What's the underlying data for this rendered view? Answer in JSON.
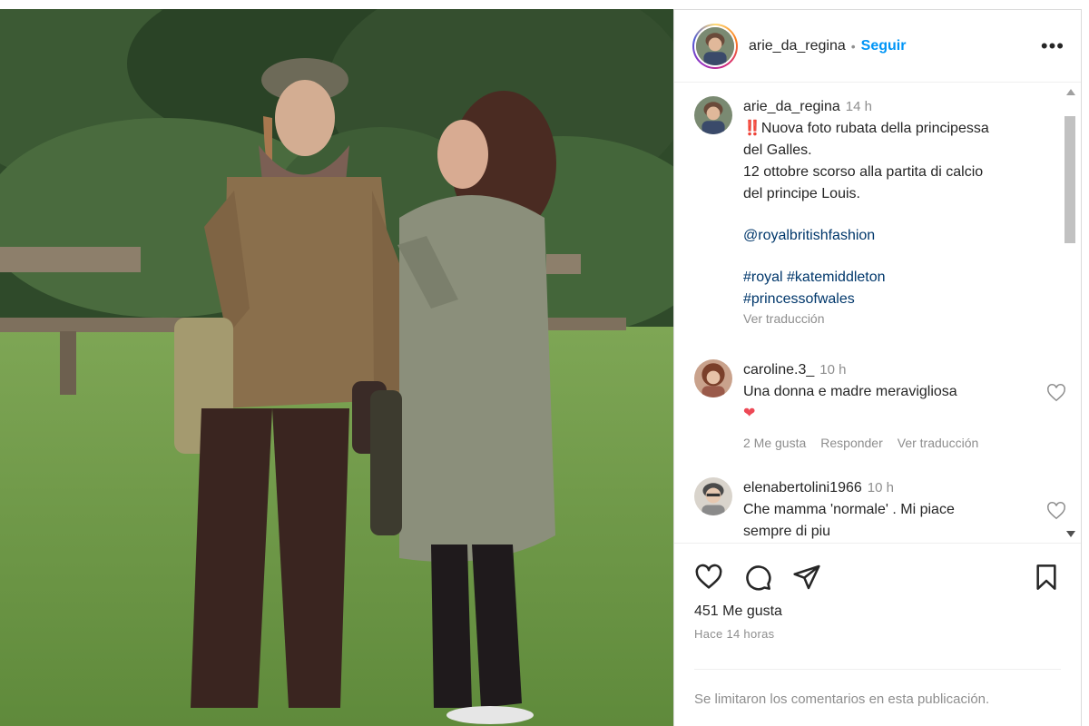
{
  "header": {
    "username": "arie_da_regina",
    "separator": "•",
    "follow_label": "Seguir",
    "more_label": "•••"
  },
  "caption": {
    "username": "arie_da_regina",
    "time": "14 h",
    "lines": [
      "‼️Nuova foto rubata della principessa",
      "del Galles.",
      "12 ottobre scorso alla partita di calcio",
      "del principe Louis."
    ],
    "mention": "@royalbritishfashion",
    "hashtags_line1": "#royal #katemiddleton",
    "hashtags_line2": "#princessofwales",
    "translate": "Ver traducción"
  },
  "comments": [
    {
      "username": "caroline.3_",
      "time": "10 h",
      "text": "Una donna e madre meravigliosa",
      "emoji": "❤",
      "likes": "2 Me gusta",
      "reply": "Responder",
      "translate": "Ver traducción"
    },
    {
      "username": "elenabertolini1966",
      "time": "10 h",
      "text_line1": "Che mamma 'normale' . Mi piace",
      "text_line2": "sempre di piu"
    }
  ],
  "actions": {
    "like_count": "451 Me gusta",
    "time_ago": "Hace 14 horas",
    "icons": [
      "heart-icon",
      "comment-icon",
      "share-icon",
      "bookmark-icon"
    ]
  },
  "footer": {
    "limited": "Se limitaron los comentarios en esta publicación."
  },
  "colors": {
    "follow": "#0095f6",
    "link": "#00376b",
    "secondary": "#8e8e8e",
    "heart": "#ed4956"
  }
}
